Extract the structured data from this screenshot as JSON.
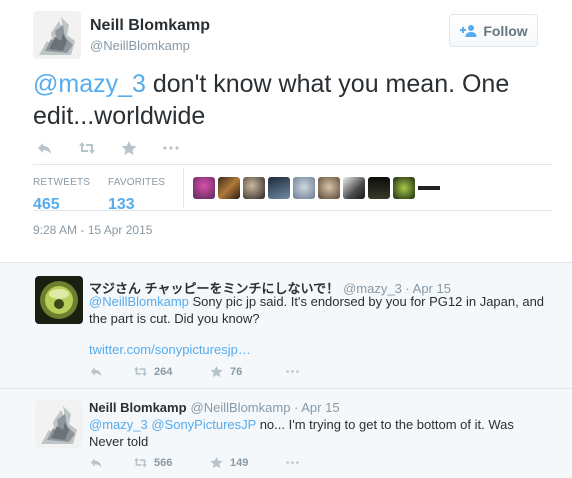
{
  "main": {
    "author_name": "Neill Blomkamp",
    "author_handle": "@NeillBlomkamp",
    "follow_label": "Follow",
    "text_mention": "@mazy_3",
    "text_body": " don't know what you mean. One edit...worldwide",
    "retweets_label": "RETWEETS",
    "retweets_count": "465",
    "favorites_label": "FAVORITES",
    "favorites_count": "133",
    "timestamp": "9:28 AM - 15 Apr 2015"
  },
  "replies": [
    {
      "name": "マジさん チャッピーをミンチにしないで！",
      "meta": "@mazy_3 · Apr 15",
      "mention": "@NeillBlomkamp",
      "text": " Sony pic jp said. It's endorsed by you for PG12 in Japan, and the part is cut. Did you know?",
      "link": "twitter.com/sonypicturesjp…",
      "retweets": "264",
      "favorites": "76"
    },
    {
      "name": "Neill Blomkamp",
      "meta": "@NeillBlomkamp · Apr 15",
      "mention1": "@mazy_3",
      "mention2": "@SonyPicturesJP",
      "text": " no... I'm trying to get to the bottom of it. Was Never told",
      "retweets": "566",
      "favorites": "149"
    }
  ],
  "colors": {
    "accent": "#55acee",
    "muted": "#8899a6",
    "text": "#292f33",
    "reply_bg": "#f5f8fa",
    "border": "#e1e8ed"
  },
  "icons": [
    "reply-icon",
    "retweet-icon",
    "favorite-icon",
    "more-icon",
    "follow-person-icon"
  ]
}
